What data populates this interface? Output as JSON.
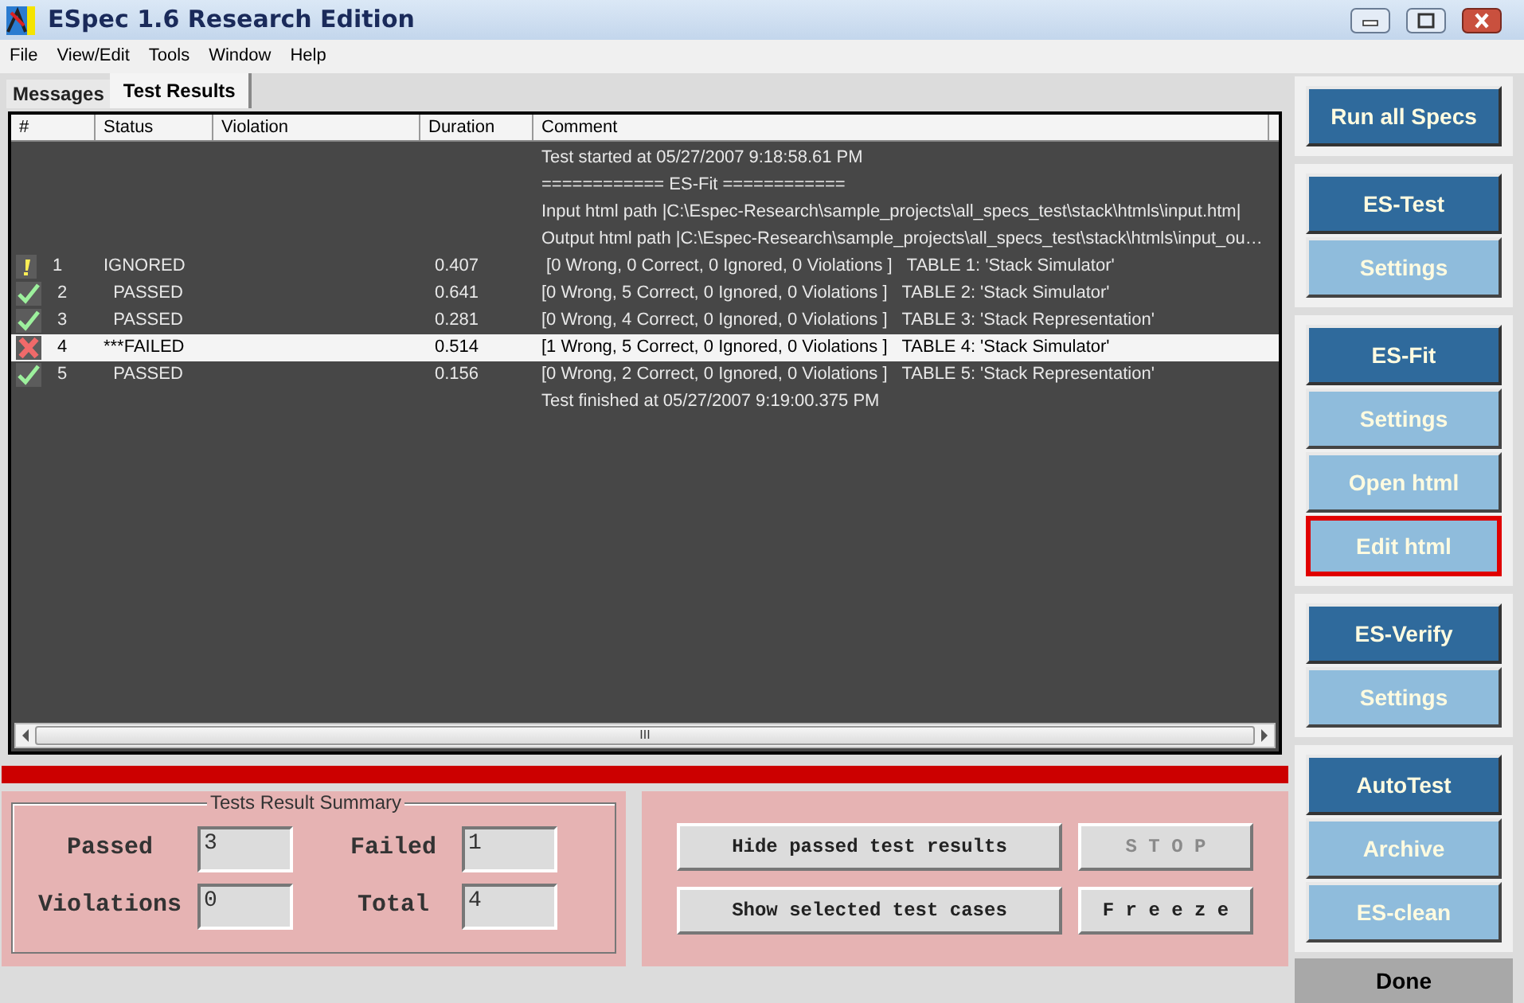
{
  "window": {
    "title": "ESpec 1.6 Research Edition"
  },
  "menu": [
    "File",
    "View/Edit",
    "Tools",
    "Window",
    "Help"
  ],
  "tabs": [
    {
      "label": "Messages",
      "selected": false
    },
    {
      "label": "Test Results",
      "selected": true
    }
  ],
  "table": {
    "columns": [
      "#",
      "Status",
      "Violation",
      "Duration",
      "Comment"
    ],
    "rows": [
      {
        "kind": "message",
        "comment": "Test started at 05/27/2007 9:18:58.61 PM"
      },
      {
        "kind": "message",
        "comment": "============ ES-Fit ============"
      },
      {
        "kind": "message",
        "comment": "Input html path |C:\\Espec-Research\\sample_projects\\all_specs_test\\stack\\htmls\\input.htm|"
      },
      {
        "kind": "message",
        "comment": "Output html path |C:\\Espec-Research\\sample_projects\\all_specs_test\\stack\\htmls\\input_ou…"
      },
      {
        "kind": "ignored",
        "selected": false,
        "number": "1",
        "status": "IGNORED",
        "duration": "0.407",
        "comment": " [0 Wrong, 0 Correct, 0 Ignored, 0 Violations ]   TABLE 1: 'Stack Simulator'"
      },
      {
        "kind": "passed",
        "selected": false,
        "number": "2",
        "status": "  PASSED",
        "duration": "0.641",
        "comment": "[0 Wrong, 5 Correct, 0 Ignored, 0 Violations ]   TABLE 2: 'Stack Simulator'"
      },
      {
        "kind": "passed",
        "selected": false,
        "number": "3",
        "status": "  PASSED",
        "duration": "0.281",
        "comment": "[0 Wrong, 4 Correct, 0 Ignored, 0 Violations ]   TABLE 3: 'Stack Representation'"
      },
      {
        "kind": "failed",
        "selected": true,
        "number": "4",
        "status": "***FAILED",
        "duration": "0.514",
        "comment": "[1 Wrong, 5 Correct, 0 Ignored, 0 Violations ]   TABLE 4: 'Stack Simulator'"
      },
      {
        "kind": "passed",
        "selected": false,
        "number": "5",
        "status": "  PASSED",
        "duration": "0.156",
        "comment": "[0 Wrong, 2 Correct, 0 Ignored, 0 Violations ]   TABLE 5: 'Stack Representation'"
      },
      {
        "kind": "message",
        "comment": "Test finished at 05/27/2007 9:19:00.375 PM"
      }
    ]
  },
  "scrollbar_grip": "III",
  "summary": {
    "title": "Tests Result Summary",
    "fields": [
      {
        "label": "Passed",
        "value": "3"
      },
      {
        "label": "Failed",
        "value": "1"
      },
      {
        "label": "Violations",
        "value": "0"
      },
      {
        "label": "Total",
        "value": "4"
      }
    ]
  },
  "actions": [
    {
      "label": "Hide passed test results",
      "disabled": false
    },
    {
      "label": "S T O P",
      "disabled": true
    },
    {
      "label": "Show selected test cases",
      "disabled": false
    },
    {
      "label": "F r e e z e",
      "disabled": false
    }
  ],
  "side_groups": [
    {
      "buttons": [
        {
          "label": "Run all Specs",
          "kind": "primary",
          "focused": false
        }
      ]
    },
    {
      "buttons": [
        {
          "label": "ES-Test",
          "kind": "primary",
          "focused": false
        },
        {
          "label": "Settings",
          "kind": "secondary",
          "focused": false
        }
      ]
    },
    {
      "buttons": [
        {
          "label": "ES-Fit",
          "kind": "primary",
          "focused": false
        },
        {
          "label": "Settings",
          "kind": "secondary",
          "focused": false
        },
        {
          "label": "Open html",
          "kind": "secondary",
          "focused": false
        },
        {
          "label": "Edit html",
          "kind": "secondary",
          "focused": true
        }
      ]
    },
    {
      "buttons": [
        {
          "label": "ES-Verify",
          "kind": "primary",
          "focused": false
        },
        {
          "label": "Settings",
          "kind": "secondary",
          "focused": false
        }
      ]
    },
    {
      "buttons": [
        {
          "label": "AutoTest",
          "kind": "primary",
          "focused": false
        },
        {
          "label": "Archive",
          "kind": "secondary",
          "focused": false
        },
        {
          "label": "ES-clean",
          "kind": "secondary",
          "focused": false
        }
      ]
    }
  ],
  "done_button": "Done"
}
